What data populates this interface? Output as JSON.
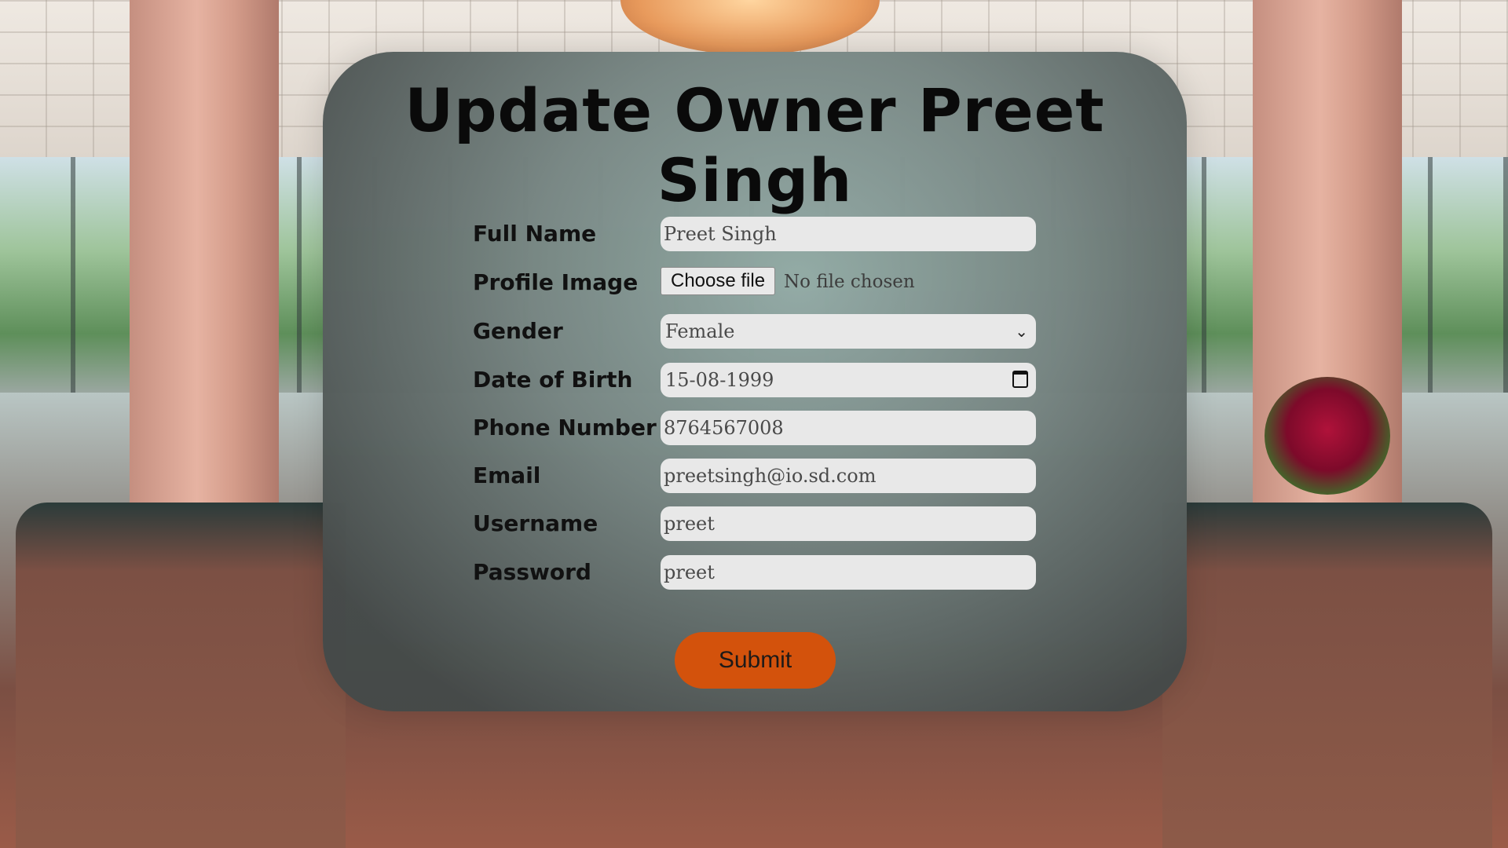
{
  "page": {
    "title": "Update Owner Preet Singh"
  },
  "form": {
    "full_name": {
      "label": "Full Name",
      "value": "Preet Singh"
    },
    "profile_image": {
      "label": "Profile Image",
      "button_label": "Choose file",
      "status": "No file chosen"
    },
    "gender": {
      "label": "Gender",
      "selected": "Female"
    },
    "dob": {
      "label": "Date of Birth",
      "value": "15-08-1999"
    },
    "phone": {
      "label": "Phone Number",
      "value": "8764567008"
    },
    "email": {
      "label": "Email",
      "value": "preetsingh@io.sd.com"
    },
    "username": {
      "label": "Username",
      "value": "preet"
    },
    "password": {
      "label": "Password",
      "value": "preet"
    },
    "submit_label": "Submit"
  },
  "colors": {
    "submit_bg": "#d3520c",
    "field_bg": "#e8e8e8"
  },
  "icons": {
    "select": "chevron-down-icon",
    "date": "calendar-icon"
  }
}
